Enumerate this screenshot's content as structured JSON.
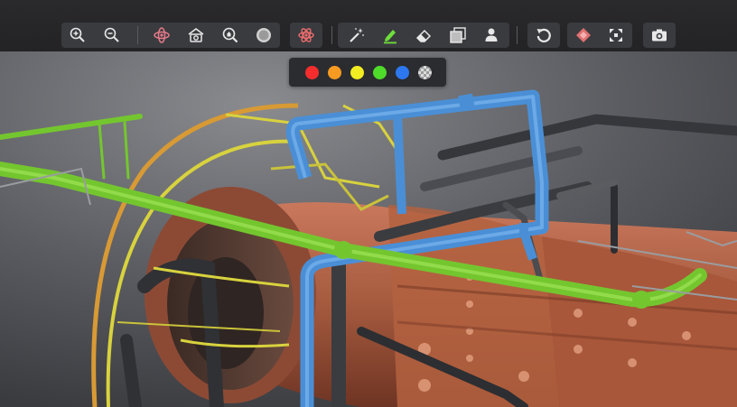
{
  "toolbar": {
    "tools": [
      {
        "id": "zoom-in",
        "icon": "zoom-in-icon"
      },
      {
        "id": "zoom-out",
        "icon": "zoom-out-icon"
      },
      {
        "id": "orbit",
        "icon": "orbit-icon"
      },
      {
        "id": "home-view",
        "icon": "home-camera-icon"
      },
      {
        "id": "zoom-to-fit",
        "icon": "zoom-fit-icon"
      },
      {
        "id": "render-mode",
        "icon": "circle-icon"
      },
      {
        "id": "explode",
        "icon": "atom-icon"
      },
      {
        "id": "magic-wand",
        "icon": "magic-wand-icon"
      },
      {
        "id": "highlighter",
        "icon": "highlighter-icon"
      },
      {
        "id": "eraser",
        "icon": "eraser-icon"
      },
      {
        "id": "xray",
        "icon": "xray-box-icon"
      },
      {
        "id": "person",
        "icon": "person-icon"
      },
      {
        "id": "reset",
        "icon": "undo-icon"
      },
      {
        "id": "parts",
        "icon": "diamond-icon"
      },
      {
        "id": "fullscreen",
        "icon": "fullscreen-icon"
      },
      {
        "id": "screenshot",
        "icon": "camera-icon"
      }
    ]
  },
  "highlight_palette": {
    "colors": [
      "#f52d2d",
      "#f79a22",
      "#f2ec22",
      "#4fdb2a",
      "#2d78f0",
      "transparent"
    ]
  },
  "scene": {
    "description_icon": "gas-turbine-3d-model",
    "pipe_colors": {
      "green": "#74c62f",
      "blue": "#4a8fd6",
      "yellow": "#d8d23e",
      "orange": "#d89a35",
      "casing": "#b8644a",
      "dark": "#35373b"
    }
  }
}
